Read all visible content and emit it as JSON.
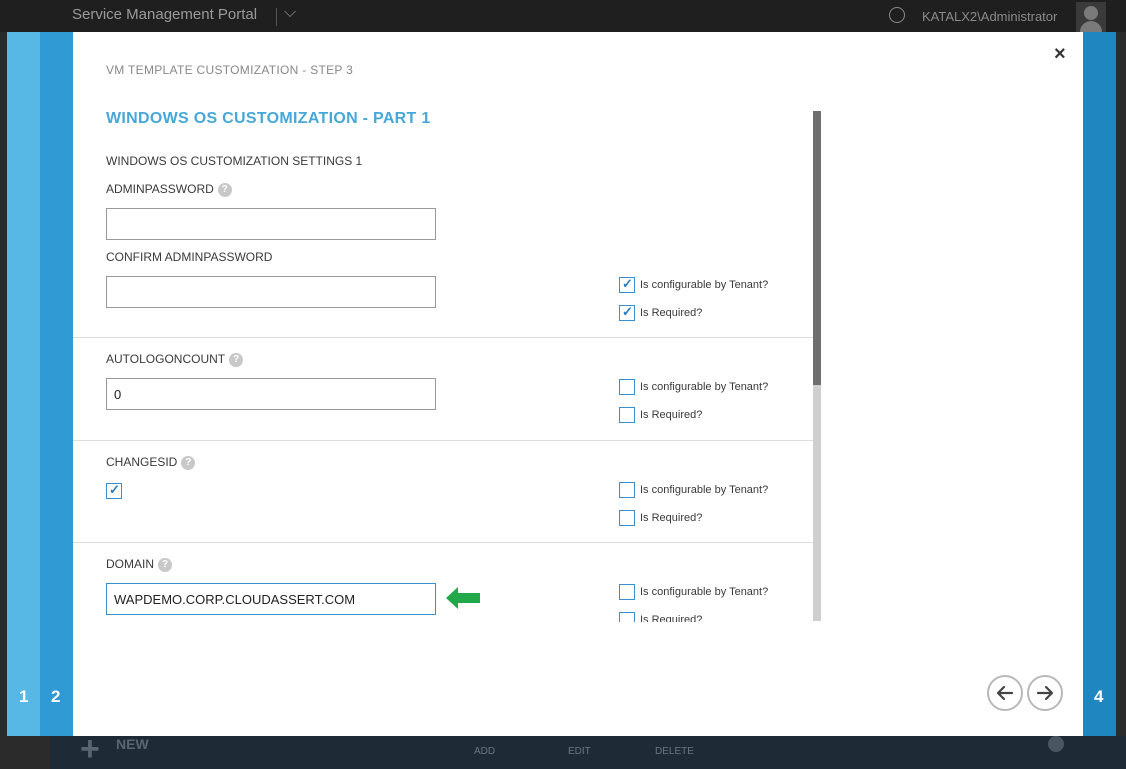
{
  "portal": {
    "title": "Service Management Portal",
    "user": "KATALX2\\Administrator",
    "bottom": {
      "new_label": "NEW",
      "commands": [
        "ADD",
        "EDIT",
        "DELETE"
      ]
    }
  },
  "wizard": {
    "steps": {
      "step1": "1",
      "step2": "2",
      "step4": "4"
    },
    "step_title": "VM TEMPLATE CUSTOMIZATION - STEP 3",
    "section_title": "WINDOWS OS CUSTOMIZATION - PART 1",
    "group_title": "WINDOWS OS CUSTOMIZATION SETTINGS 1",
    "help_glyph": "?",
    "close_glyph": "×",
    "fields": {
      "adminpassword": {
        "label": "ADMINPASSWORD",
        "value": ""
      },
      "confirm_adminpassword": {
        "label": "CONFIRM ADMINPASSWORD",
        "value": ""
      },
      "autologoncount": {
        "label": "AUTOLOGONCOUNT",
        "value": "0"
      },
      "changesid": {
        "label": "CHANGESID",
        "checked": true
      },
      "domain": {
        "label": "DOMAIN",
        "value": "WAPDEMO.CORP.CLOUDASSERT.COM"
      }
    },
    "options": {
      "configurable_label": "Is configurable by Tenant?",
      "required_label": "Is Required?",
      "adminpassword": {
        "configurable": true,
        "required": true
      },
      "autologoncount": {
        "configurable": false,
        "required": false
      },
      "changesid": {
        "configurable": false,
        "required": false
      },
      "domain": {
        "configurable": false,
        "required": false
      }
    },
    "colors": {
      "accent": "#47a7d9",
      "rail_1": "#57b8e5",
      "rail_2": "#2f9ad4",
      "rail_4": "#1f86c0",
      "arrow": "#22a84a"
    }
  }
}
